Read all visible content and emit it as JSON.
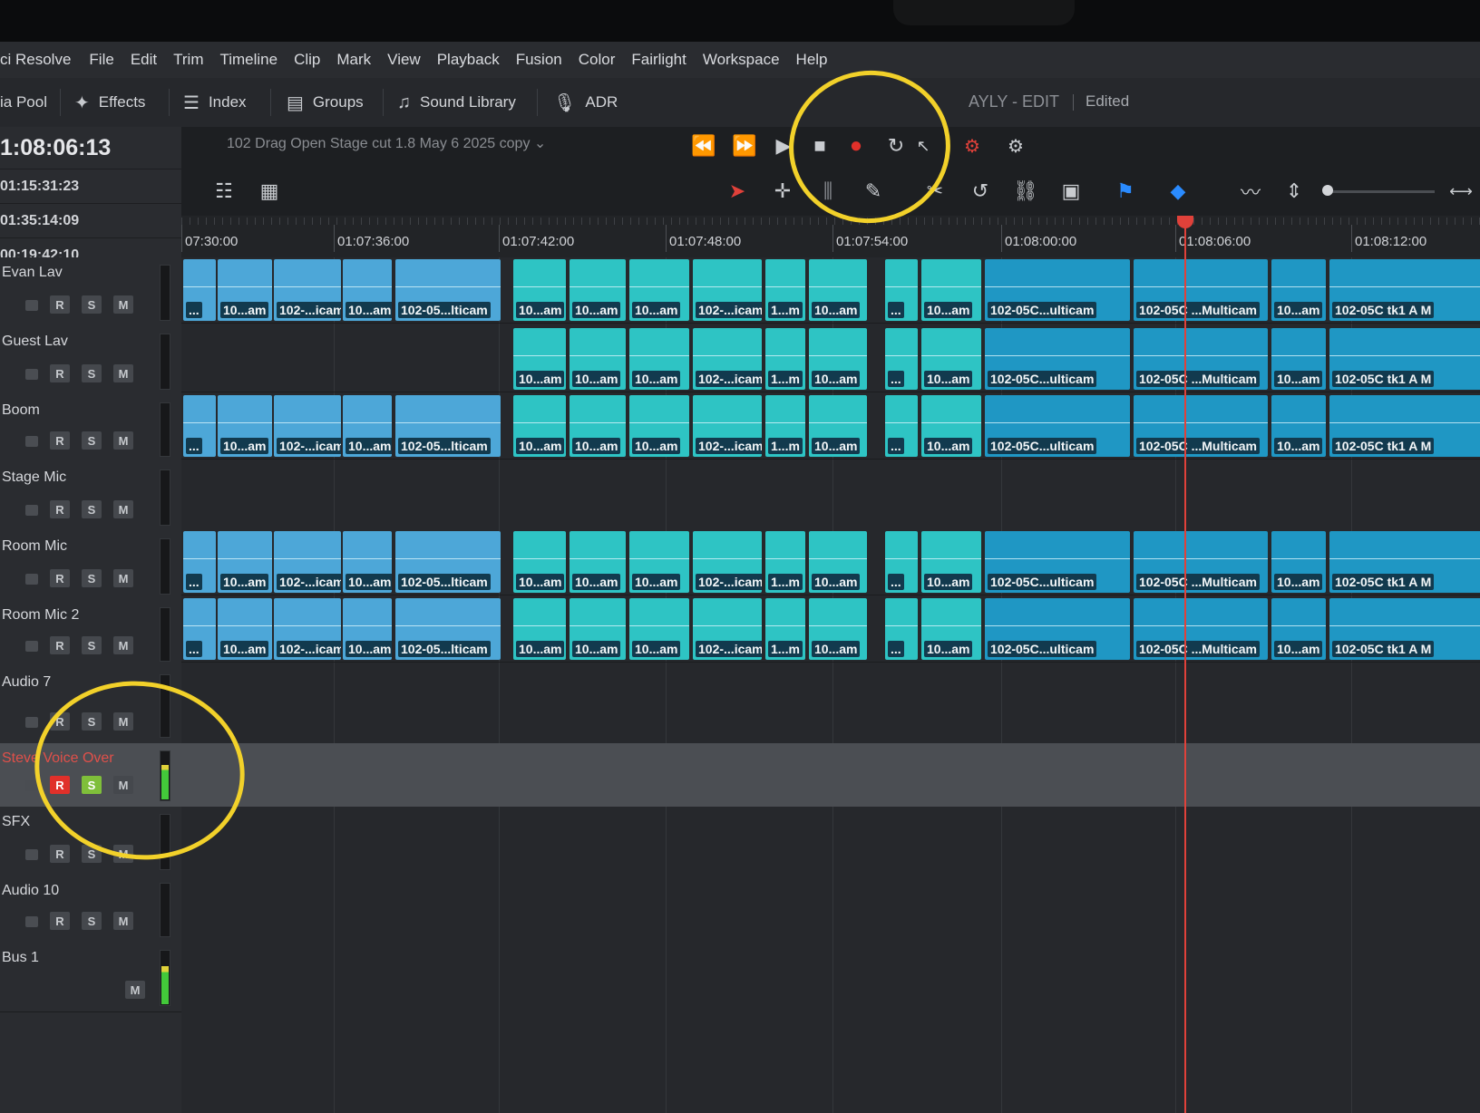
{
  "menu": [
    "ci Resolve",
    "File",
    "Edit",
    "Trim",
    "Timeline",
    "Clip",
    "Mark",
    "View",
    "Playback",
    "Fusion",
    "Color",
    "Fairlight",
    "Workspace",
    "Help"
  ],
  "toolbar": {
    "media_pool": "ia Pool",
    "effects": "Effects",
    "index": "Index",
    "groups": "Groups",
    "sound_library": "Sound Library",
    "adr": "ADR",
    "project": "AYLY - EDIT",
    "status": "Edited"
  },
  "timecodes": {
    "main": "1:08:06:13",
    "t1": "01:15:31:23",
    "t2": "01:35:14:09",
    "t3": "00:19:42:10"
  },
  "timeline_name": "102 Drag Open Stage cut 1.8 May 6 2025 copy",
  "ruler": [
    "07:30:00",
    "01:07:36:00",
    "01:07:42:00",
    "01:07:48:00",
    "01:07:54:00",
    "01:08:00:00",
    "01:08:06:00",
    "01:08:12:00"
  ],
  "tracks": [
    {
      "name": "Evan Lav",
      "buttons": [
        "R",
        "S",
        "M"
      ]
    },
    {
      "name": "Guest Lav",
      "buttons": [
        "R",
        "S",
        "M"
      ]
    },
    {
      "name": "Boom",
      "buttons": [
        "R",
        "S",
        "M"
      ]
    },
    {
      "name": "Stage Mic",
      "buttons": [
        "R",
        "S",
        "M"
      ]
    },
    {
      "name": "Room Mic",
      "buttons": [
        "R",
        "S",
        "M"
      ]
    },
    {
      "name": "Room Mic 2",
      "buttons": [
        "R",
        "S",
        "M"
      ]
    },
    {
      "name": "Audio 7",
      "buttons": [
        "R",
        "S",
        "M"
      ]
    },
    {
      "name": "Steve Voice Over",
      "buttons": [
        "R",
        "S",
        "M"
      ]
    },
    {
      "name": "SFX",
      "buttons": [
        "R",
        "S",
        "M"
      ]
    },
    {
      "name": "Audio 10",
      "buttons": [
        "R",
        "S",
        "M"
      ]
    },
    {
      "name": "Bus 1",
      "buttons": [
        "M"
      ]
    }
  ],
  "clip_labels": {
    "short": "10...am",
    "icam": "102-...icam",
    "lticam": "102-05...lticam",
    "m": "1...m",
    "dots": "...",
    "ulticam": "102-05C...ulticam",
    "multicam": "102-05C ...Multicam",
    "tk1": "102-05C tk1 A M"
  },
  "colors": {
    "clip_blue": "#4da7d8",
    "clip_teal": "#2ec4c4",
    "record_red": "#e0302a",
    "solo_green": "#7fbf3a",
    "playhead": "#e0413a",
    "annotation": "#f2d12a"
  }
}
